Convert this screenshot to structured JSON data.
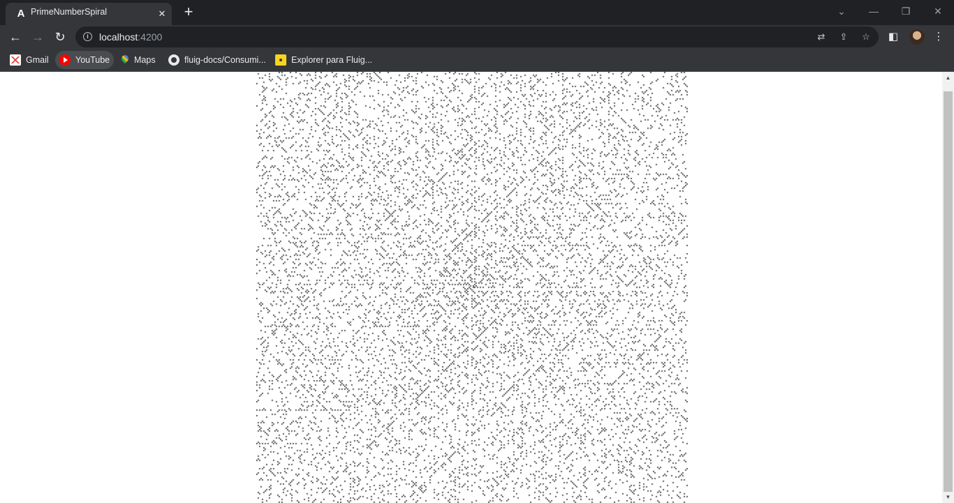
{
  "browser": {
    "tab": {
      "title": "PrimeNumberSpiral",
      "favicon": "angular-icon",
      "close_glyph": "✕"
    },
    "new_tab_glyph": "+",
    "window_controls": {
      "tab_search": "⌄",
      "minimize": "—",
      "restore": "❐",
      "close": "✕"
    },
    "nav": {
      "back": "←",
      "forward": "→",
      "reload": "↻"
    },
    "address": {
      "host": "localhost",
      "port": ":4200"
    },
    "toolbar_icons": [
      "translate-icon",
      "share-icon",
      "bookmark-star-icon",
      "side-panel-icon",
      "profile-avatar",
      "menu-icon"
    ]
  },
  "bookmarks": [
    {
      "label": "Gmail",
      "icon": "gmail-icon"
    },
    {
      "label": "YouTube",
      "icon": "youtube-icon"
    },
    {
      "label": "Maps",
      "icon": "maps-icon"
    },
    {
      "label": "fluig-docs/Consumi...",
      "icon": "github-icon"
    },
    {
      "label": "Explorer para Fluig...",
      "icon": "explorer-icon"
    }
  ],
  "page": {
    "content": "prime-number-spiral",
    "pixel_color": "#000000",
    "background_color": "#ffffff"
  }
}
